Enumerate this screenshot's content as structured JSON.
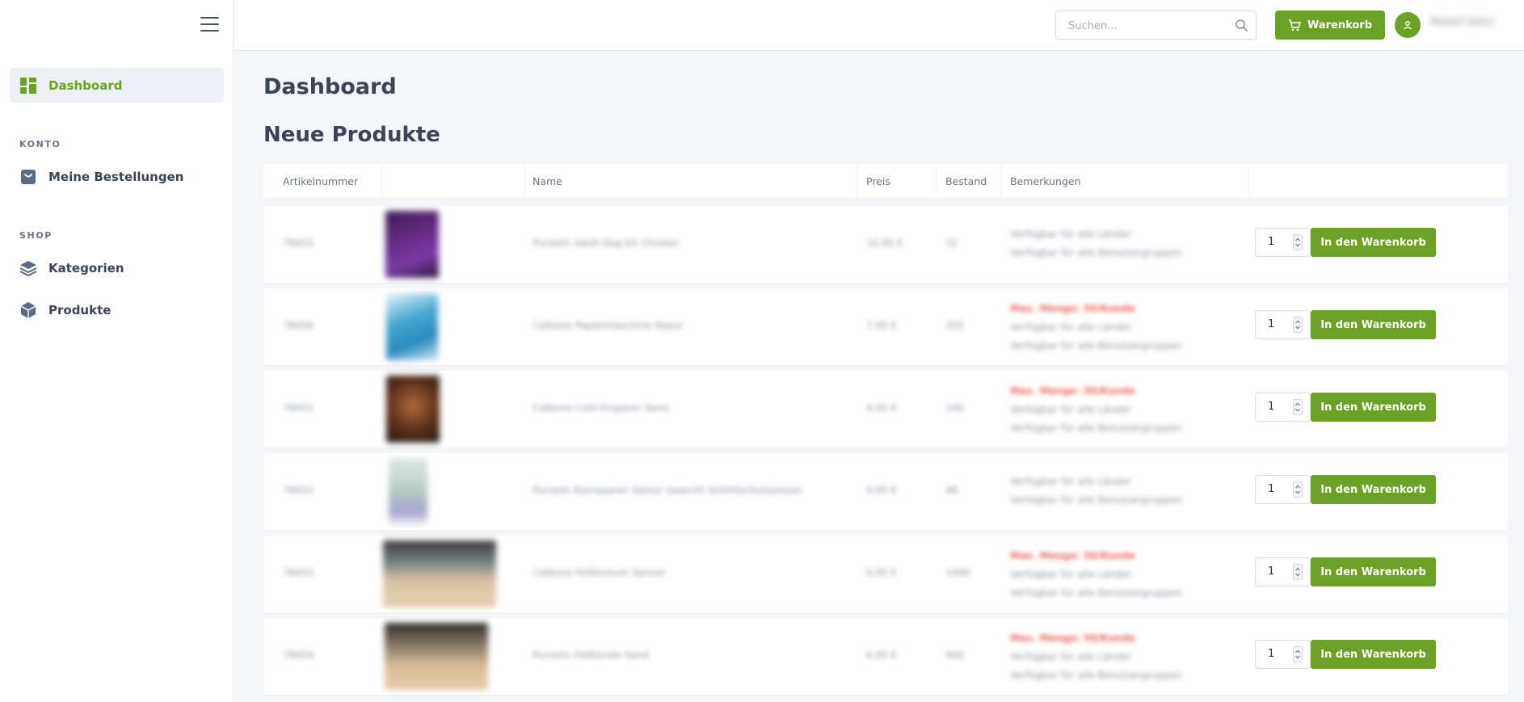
{
  "colors": {
    "accent": "#6ba124",
    "warning": "#e8675e",
    "text": "#3b4556"
  },
  "sidebar": {
    "menu_icon": "hamburger-icon",
    "items": [
      {
        "label": "Dashboard",
        "icon": "dashboard-grid-icon",
        "active": true
      }
    ],
    "sections": [
      {
        "title": "KONTO",
        "items": [
          {
            "label": "Meine Bestellungen",
            "icon": "shopping-bag-icon"
          }
        ]
      },
      {
        "title": "SHOP",
        "items": [
          {
            "label": "Kategorien",
            "icon": "layers-icon"
          },
          {
            "label": "Produkte",
            "icon": "box-icon"
          }
        ]
      }
    ]
  },
  "header": {
    "search_placeholder": "Suchen...",
    "search_icon": "search-icon",
    "cart_label": "Warenkorb",
    "cart_icon": "cart-icon",
    "avatar_icon": "user-icon",
    "username": "Robert Kahn"
  },
  "main": {
    "title": "Dashboard",
    "section_title": "Neue Produkte",
    "columns": [
      "Artikelnummer",
      "",
      "Name",
      "Preis",
      "Bestand",
      "Bemerkungen",
      ""
    ],
    "add_label": "In den Warenkorb",
    "rows": [
      {
        "sku": "78455",
        "name": "Purzelin Adult Dog 6X Chicken",
        "price": "10,95 €",
        "stock": "32",
        "warning": "",
        "remarks": [
          "Verfügbar für alle Länder",
          "Verfügbar für alle Benutzergruppen"
        ],
        "qty": "1"
      },
      {
        "sku": "78456",
        "name": "Calbone Papiermaschine Nasur",
        "price": "7,95 €",
        "stock": "205",
        "warning": "Max. Menge: 50/Kunde",
        "remarks": [
          "Verfügbar für alle Länder",
          "Verfügbar für alle Benutzergruppen"
        ],
        "qty": "1"
      },
      {
        "sku": "78451",
        "name": "Calbone Cold Emperor Sand",
        "price": "4,95 €",
        "stock": "140",
        "warning": "Max. Menge: 50/Kunde",
        "remarks": [
          "Verfügbar für alle Länder",
          "Verfügbar für alle Benutzergruppen"
        ],
        "qty": "1"
      },
      {
        "sku": "78452",
        "name": "Purzelin Kornsparen Senior Gewicht Schlittschuhsenson",
        "price": "9,95 €",
        "stock": "48",
        "warning": "",
        "remarks": [
          "Verfügbar für alle Länder",
          "Verfügbar für alle Benutzergruppen"
        ],
        "qty": "1"
      },
      {
        "sku": "78453",
        "name": "Calbone Fellbüroum Sensor",
        "price": "6,95 €",
        "stock": "1000",
        "warning": "Max. Menge: 50/Kunde",
        "remarks": [
          "Verfügbar für alle Länder",
          "Verfügbar für alle Benutzergruppen"
        ],
        "qty": "1"
      },
      {
        "sku": "78454",
        "name": "Purzelin Fellbürste Sand",
        "price": "6,95 €",
        "stock": "960",
        "warning": "Max. Menge: 50/Kunde",
        "remarks": [
          "Verfügbar für alle Länder",
          "Verfügbar für alle Benutzergruppen"
        ],
        "qty": "1"
      }
    ]
  }
}
